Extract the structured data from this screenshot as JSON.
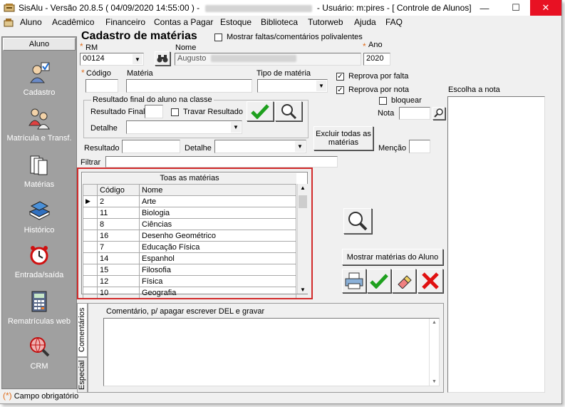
{
  "window": {
    "title_app": "SisAlu - Versão 20.8.5 ( 04/09/2020 14:55:00 ) -",
    "title_user": "- Usuário: m:pires - [ Controle de Alunos]"
  },
  "menu": [
    "Aluno",
    "Acadêmico",
    "Financeiro",
    "Contas a Pagar",
    "Estoque",
    "Biblioteca",
    "Tutorweb",
    "Ajuda",
    "FAQ"
  ],
  "sidebar": {
    "header": "Aluno",
    "items": [
      {
        "label": "Cadastro",
        "icon": "user-check-icon"
      },
      {
        "label": "Matrícula e Transf.",
        "icon": "people-icon"
      },
      {
        "label": "Matérias",
        "icon": "folders-icon"
      },
      {
        "label": "Histórico",
        "icon": "books-icon"
      },
      {
        "label": "Entrada/saída",
        "icon": "alarm-clock-icon"
      },
      {
        "label": "Rematrículas web",
        "icon": "calculator-icon"
      },
      {
        "label": "CRM",
        "icon": "globe-magnifier-icon"
      }
    ]
  },
  "form": {
    "title": "Cadastro de matérias",
    "show_notes_label": "Mostrar faltas/comentários polivalentes",
    "rm_label": "RM",
    "rm_value": "00124",
    "name_label": "Nome",
    "name_value": "Augusto",
    "year_label": "Ano",
    "year_value": "2020",
    "code_label": "Código",
    "subject_label": "Matéria",
    "subject_type_label": "Tipo de matéria",
    "fail_by_absence": "Reprova por falta",
    "fail_by_grade": "Reprova por nota",
    "block_label": "bloquear",
    "grade_label": "Nota",
    "choose_grade_label": "Escolha a nota",
    "final_result_group": "Resultado final do aluno na classe",
    "final_result_label": "Resultado Final",
    "lock_result_label": "Travar Resultado",
    "detail_label": "Detalhe",
    "delete_all_button": "Excluir todas as matérias",
    "result_label": "Resultado",
    "detail2_label": "Detalhe",
    "mention_label": "Menção",
    "filter_label": "Filtrar",
    "show_student_subjects_button": "Mostrar matérias do Aluno",
    "comment_label": "Comentário, p/ apagar escrever DEL e gravar",
    "tab_comments": "Comentários",
    "tab_special": "Especial",
    "required_legend": "Campo obrigatório",
    "required_mark": "(*)"
  },
  "grid": {
    "title": "Toas as matérias",
    "columns": [
      "Código",
      "Nome"
    ],
    "rows": [
      [
        "2",
        "Arte"
      ],
      [
        "11",
        "Biologia"
      ],
      [
        "8",
        "Ciências"
      ],
      [
        "16",
        "Desenho Geométrico"
      ],
      [
        "7",
        "Educação Física"
      ],
      [
        "14",
        "Espanhol"
      ],
      [
        "15",
        "Filosofia"
      ],
      [
        "12",
        "Física"
      ],
      [
        "10",
        "Geografia"
      ]
    ]
  },
  "colors": {
    "highlight": "#d22a2a",
    "required": "#e07020",
    "ok_green": "#1ea01e",
    "cancel_red": "#e01010"
  }
}
